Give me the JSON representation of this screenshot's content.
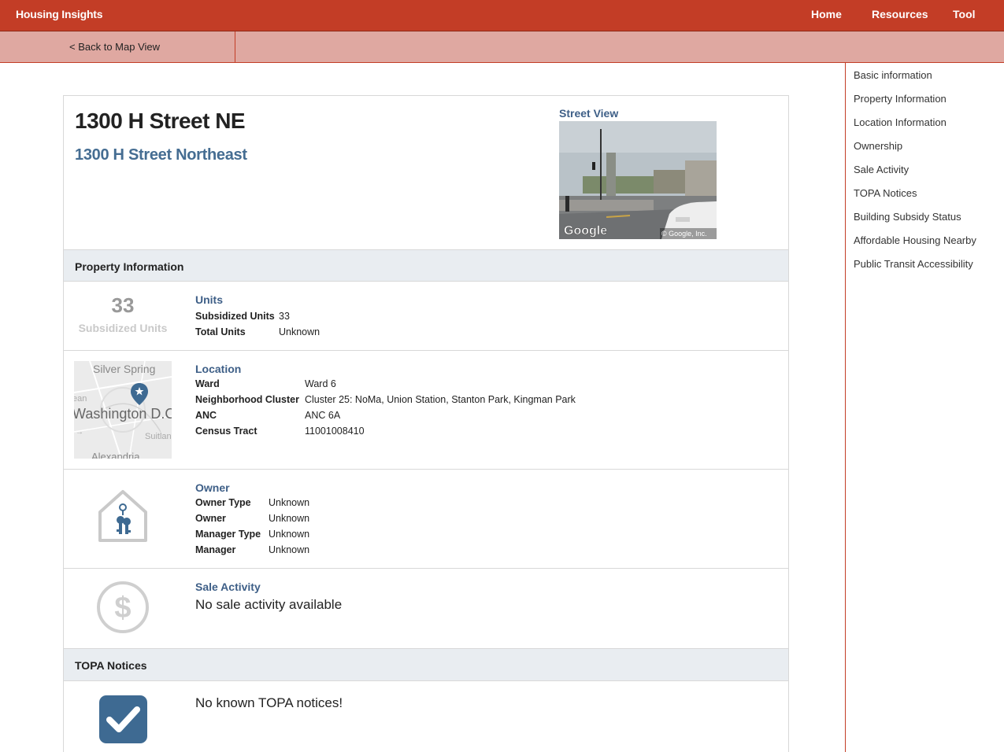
{
  "header": {
    "brand": "Housing Insights",
    "nav": [
      "Home",
      "Resources",
      "Tool"
    ]
  },
  "subnav": {
    "back_label": "< Back to Map View"
  },
  "sidebar": {
    "items": [
      "Basic information",
      "Property Information",
      "Location Information",
      "Ownership",
      "Sale Activity",
      "TOPA Notices",
      "Building Subsidy Status",
      "Affordable Housing Nearby",
      "Public Transit Accessibility"
    ]
  },
  "property": {
    "title": "1300 H Street NE",
    "address": "1300 H Street Northeast",
    "street_view_label": "Street View",
    "street_view_brand": "Google",
    "street_view_credit": "© Google, Inc."
  },
  "property_info": {
    "heading": "Property Information",
    "units": {
      "big_number": "33",
      "big_label": "Subsidized Units",
      "title": "Units",
      "rows": [
        {
          "k": "Subsidized Units",
          "v": "33"
        },
        {
          "k": "Total Units",
          "v": "Unknown"
        }
      ]
    },
    "location": {
      "title": "Location",
      "map_labels": [
        "Silver Spring",
        "Washington D.C",
        "Suitlan",
        "Alexandria",
        "ean"
      ],
      "rows": [
        {
          "k": "Ward",
          "v": "Ward 6"
        },
        {
          "k": "Neighborhood Cluster",
          "v": "Cluster 25: NoMa, Union Station, Stanton Park, Kingman Park"
        },
        {
          "k": "ANC",
          "v": "ANC 6A"
        },
        {
          "k": "Census Tract",
          "v": "11001008410"
        }
      ]
    },
    "owner": {
      "title": "Owner",
      "rows": [
        {
          "k": "Owner Type",
          "v": "Unknown"
        },
        {
          "k": "Owner",
          "v": "Unknown"
        },
        {
          "k": "Manager Type",
          "v": "Unknown"
        },
        {
          "k": "Manager",
          "v": "Unknown"
        }
      ]
    },
    "sale": {
      "title": "Sale Activity",
      "message": "No sale activity available"
    }
  },
  "topa": {
    "heading": "TOPA Notices",
    "message": "No known TOPA notices!"
  },
  "colors": {
    "brand_red": "#c33d26",
    "subbar_pink": "#dfa8a1",
    "link_blue": "#3e5f87",
    "check_blue": "#3e6a92"
  },
  "icons": {
    "owner": "house-keys-icon",
    "sale": "dollar-circle-icon",
    "topa": "checkbox-checked-icon",
    "map_pin": "map-pin-star-icon"
  }
}
